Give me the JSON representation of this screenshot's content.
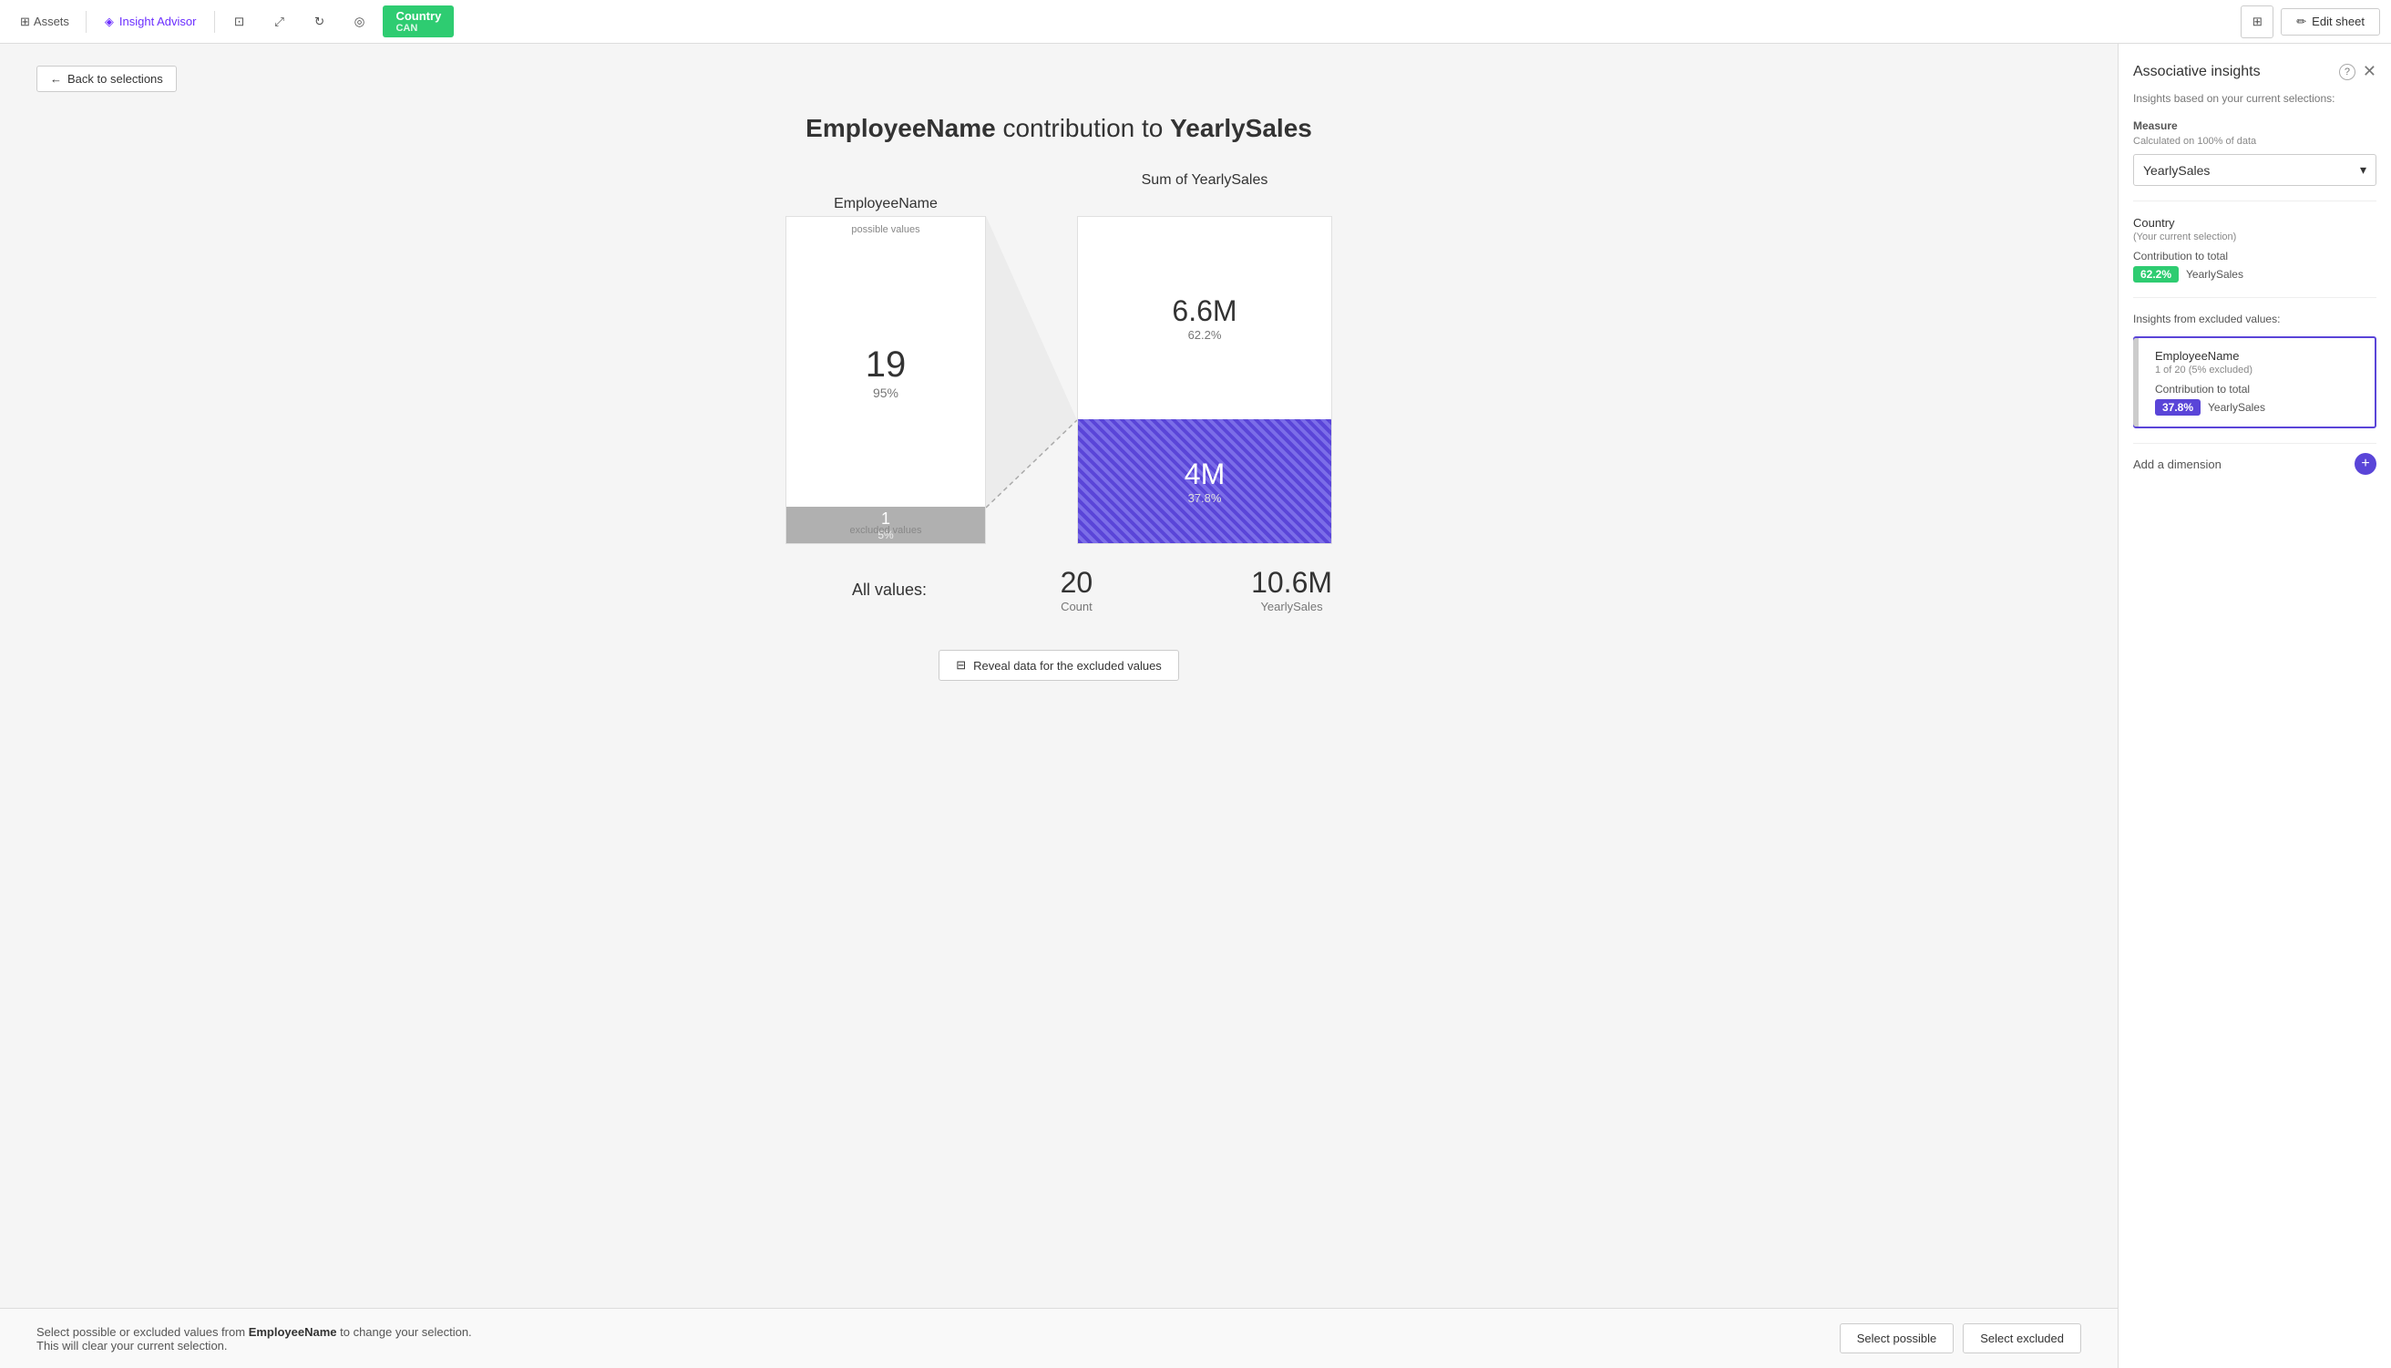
{
  "toolbar": {
    "assets_label": "Assets",
    "insight_advisor_label": "Insight Advisor",
    "edit_sheet_label": "Edit sheet",
    "country_tab_label": "Country",
    "country_tab_sub": "CAN"
  },
  "page": {
    "back_btn": "Back to selections",
    "title_field": "EmployeeName",
    "title_connector": " contribution to ",
    "title_measure": "YearlySales"
  },
  "chart": {
    "left_header": "EmployeeName",
    "right_header": "Sum of YearlySales",
    "possible_label": "possible values",
    "excluded_label": "excluded values",
    "possible_count": "19",
    "possible_pct": "95%",
    "excluded_count": "1",
    "excluded_pct": "5%",
    "possible_sales": "6.6M",
    "possible_sales_pct": "62.2%",
    "excluded_sales": "4M",
    "excluded_sales_pct": "37.8%"
  },
  "all_values": {
    "label": "All values:",
    "count": "20",
    "count_label": "Count",
    "sales": "10.6M",
    "sales_label": "YearlySales"
  },
  "reveal_btn": "Reveal data for the excluded values",
  "bottom_bar": {
    "text_prefix": "Select possible or excluded values from ",
    "field_name": "EmployeeName",
    "text_suffix": " to change your selection. This will clear your current selection.",
    "select_possible": "Select possible",
    "select_excluded": "Select excluded"
  },
  "right_panel": {
    "title": "Associative insights",
    "subtitle": "Insights based on your current selections:",
    "measure_section": "Measure",
    "measure_sub": "Calculated on 100% of data",
    "measure_value": "YearlySales",
    "country_section": {
      "title": "Country",
      "sub": "(Your current selection)",
      "contribution_label": "Contribution to total",
      "badge": "62.2%",
      "measure": "YearlySales"
    },
    "excluded_section_label": "Insights from excluded values:",
    "excluded_card": {
      "title": "EmployeeName",
      "sub": "1 of 20 (5% excluded)",
      "contribution_label": "Contribution to total",
      "badge": "37.8%",
      "measure": "YearlySales"
    },
    "add_dimension": "Add a dimension"
  }
}
